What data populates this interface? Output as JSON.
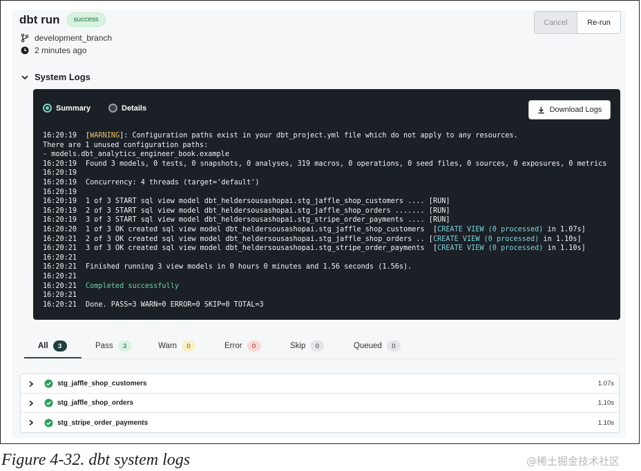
{
  "header": {
    "title": "dbt run",
    "status": "success",
    "branch": "development_branch",
    "time_ago": "2 minutes ago",
    "cancel_label": "Cancel",
    "rerun_label": "Re-run"
  },
  "system_logs": {
    "title": "System Logs",
    "summary_label": "Summary",
    "details_label": "Details",
    "selected": "Summary",
    "download_label": "Download Logs",
    "lines": [
      {
        "ts": "16:20:19",
        "parts": [
          {
            "t": "[",
            "c": ""
          },
          {
            "t": "WARNING",
            "c": "warn"
          },
          {
            "t": "]: Configuration paths exist in your dbt_project.yml file which do not apply to any resources.",
            "c": ""
          }
        ]
      },
      {
        "ts": "",
        "parts": [
          {
            "t": "There are 1 unused configuration paths:",
            "c": ""
          }
        ]
      },
      {
        "ts": "",
        "parts": [
          {
            "t": "- models.dbt_analytics_engineer_book.example",
            "c": ""
          }
        ]
      },
      {
        "ts": "16:20:19",
        "parts": [
          {
            "t": "Found 3 models, 0 tests, 0 snapshots, 0 analyses, 319 macros, 0 operations, 0 seed files, 0 sources, 0 exposures, 0 metrics",
            "c": ""
          }
        ]
      },
      {
        "ts": "16:20:19",
        "parts": []
      },
      {
        "ts": "16:20:19",
        "parts": [
          {
            "t": "Concurrency: 4 threads (target='default')",
            "c": ""
          }
        ]
      },
      {
        "ts": "16:20:19",
        "parts": []
      },
      {
        "ts": "16:20:19",
        "parts": [
          {
            "t": "1 of 3 START sql view model dbt_heldersousashopai.stg_jaffle_shop_customers .... [RUN]",
            "c": ""
          }
        ]
      },
      {
        "ts": "16:20:19",
        "parts": [
          {
            "t": "2 of 3 START sql view model dbt_heldersousashopai.stg_jaffle_shop_orders ....... [RUN]",
            "c": ""
          }
        ]
      },
      {
        "ts": "16:20:19",
        "parts": [
          {
            "t": "3 of 3 START sql view model dbt_heldersousashopai.stg_stripe_order_payments .... [RUN]",
            "c": ""
          }
        ]
      },
      {
        "ts": "16:20:20",
        "parts": [
          {
            "t": "1 of 3 OK created sql view model dbt_heldersousashopai.stg_jaffle_shop_customers  [",
            "c": ""
          },
          {
            "t": "CREATE VIEW (0 processed)",
            "c": "cyan"
          },
          {
            "t": " in 1.07s]",
            "c": ""
          }
        ]
      },
      {
        "ts": "16:20:21",
        "parts": [
          {
            "t": "2 of 3 OK created sql view model dbt_heldersousashopai.stg_jaffle_shop_orders .. [",
            "c": ""
          },
          {
            "t": "CREATE VIEW (0 processed)",
            "c": "cyan"
          },
          {
            "t": " in 1.10s]",
            "c": ""
          }
        ]
      },
      {
        "ts": "16:20:21",
        "parts": [
          {
            "t": "3 of 3 OK created sql view model dbt_heldersousashopai.stg_stripe_order_payments  [",
            "c": ""
          },
          {
            "t": "CREATE VIEW (0 processed)",
            "c": "cyan"
          },
          {
            "t": " in 1.10s]",
            "c": ""
          }
        ]
      },
      {
        "ts": "16:20:21",
        "parts": []
      },
      {
        "ts": "16:20:21",
        "parts": [
          {
            "t": "Finished running 3 view models in 0 hours 0 minutes and 1.56 seconds (1.56s).",
            "c": ""
          }
        ]
      },
      {
        "ts": "16:20:21",
        "parts": []
      },
      {
        "ts": "16:20:21",
        "parts": [
          {
            "t": "Completed successfully",
            "c": "green"
          }
        ]
      },
      {
        "ts": "16:20:21",
        "parts": []
      },
      {
        "ts": "16:20:21",
        "parts": [
          {
            "t": "Done. PASS=3 WARN=0 ERROR=0 SKIP=0 TOTAL=3",
            "c": ""
          }
        ]
      }
    ]
  },
  "tabs": [
    {
      "label": "All",
      "count": "3",
      "bg": "#20403f",
      "fg": "#ffffff"
    },
    {
      "label": "Pass",
      "count": "3",
      "bg": "#d9f3e3",
      "fg": "#1d6b3b"
    },
    {
      "label": "Warn",
      "count": "0",
      "bg": "#fbefc4",
      "fg": "#6b5200"
    },
    {
      "label": "Error",
      "count": "0",
      "bg": "#fad8d6",
      "fg": "#8a2a24"
    },
    {
      "label": "Skip",
      "count": "0",
      "bg": "#e3e5e8",
      "fg": "#333333"
    },
    {
      "label": "Queued",
      "count": "0",
      "bg": "#e3e5e8",
      "fg": "#333333"
    }
  ],
  "models": [
    {
      "name": "stg_jaffle_shop_customers",
      "duration": "1.07s"
    },
    {
      "name": "stg_jaffle_shop_orders",
      "duration": "1.10s"
    },
    {
      "name": "stg_stripe_order_payments",
      "duration": "1.10s"
    }
  ],
  "caption": "Figure 4-32. dbt system logs",
  "watermark": "@稀土掘金技术社区"
}
